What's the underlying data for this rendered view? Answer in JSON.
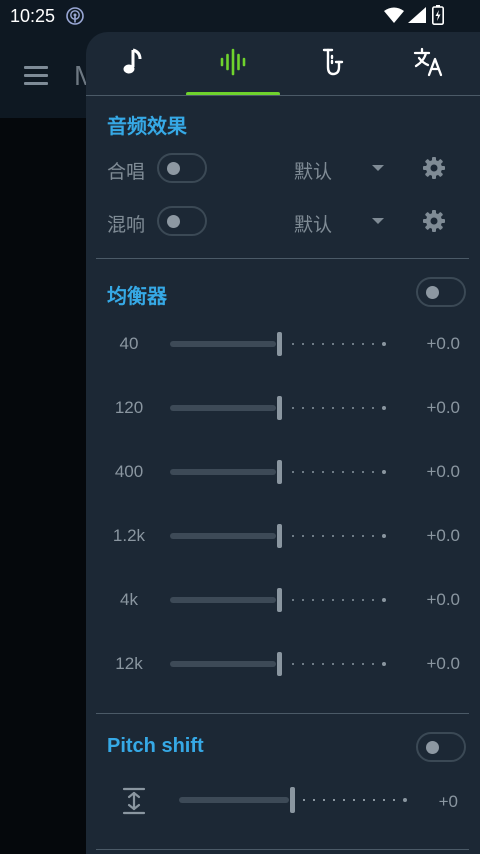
{
  "status_bar": {
    "time": "10:25"
  },
  "app_bar": {
    "title": "M"
  },
  "tabs": [
    {
      "name": "music"
    },
    {
      "name": "audio-effects",
      "selected": true
    },
    {
      "name": "vocal"
    },
    {
      "name": "translate"
    }
  ],
  "colors": {
    "accent": "#36a9e6",
    "tab_active": "#6fd32d",
    "panel": "#1c2835"
  },
  "audio_effects": {
    "title": "音频效果",
    "chorus": {
      "label": "合唱",
      "select": "默认",
      "enabled": false
    },
    "reverb": {
      "label": "混响",
      "select": "默认",
      "enabled": false
    }
  },
  "equalizer": {
    "title": "均衡器",
    "enabled": false,
    "bands": [
      {
        "label": "40",
        "value": "+0.0"
      },
      {
        "label": "120",
        "value": "+0.0"
      },
      {
        "label": "400",
        "value": "+0.0"
      },
      {
        "label": "1.2k",
        "value": "+0.0"
      },
      {
        "label": "4k",
        "value": "+0.0"
      },
      {
        "label": "12k",
        "value": "+0.0"
      }
    ]
  },
  "pitch_shift": {
    "title": "Pitch shift",
    "enabled": false,
    "value": "+0"
  }
}
